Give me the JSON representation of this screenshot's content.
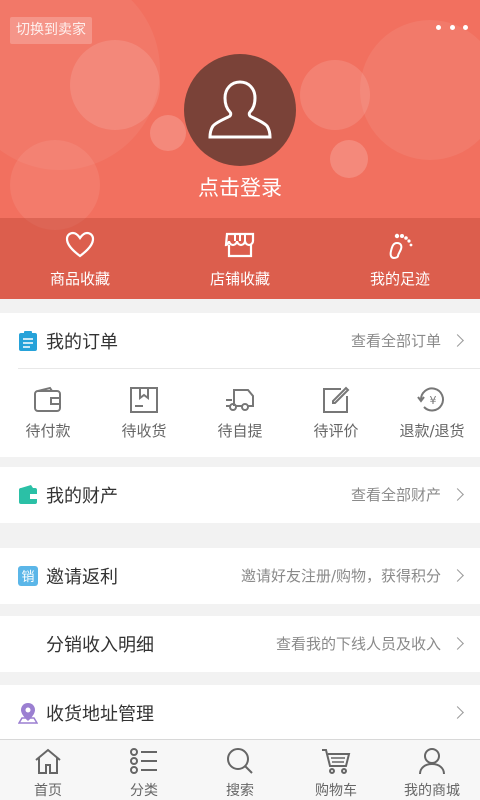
{
  "header": {
    "switch_label": "切换到卖家",
    "login_label": "点击登录",
    "favorites": [
      {
        "label": "商品收藏",
        "icon": "heart-icon"
      },
      {
        "label": "店铺收藏",
        "icon": "store-icon"
      },
      {
        "label": "我的足迹",
        "icon": "footprint-icon"
      }
    ]
  },
  "orders": {
    "title": "我的订单",
    "view_all": "查看全部订单",
    "statuses": [
      {
        "label": "待付款",
        "icon": "wallet-icon"
      },
      {
        "label": "待收货",
        "icon": "package-icon"
      },
      {
        "label": "待自提",
        "icon": "truck-icon"
      },
      {
        "label": "待评价",
        "icon": "edit-icon"
      },
      {
        "label": "退款/退货",
        "icon": "refund-icon"
      }
    ]
  },
  "assets": {
    "title": "我的财产",
    "view_all": "查看全部财产"
  },
  "invite": {
    "title": "邀请返利",
    "hint": "邀请好友注册/购物，获得积分",
    "badge": "销"
  },
  "distribution": {
    "title": "分销收入明细",
    "hint": "查看我的下线人员及收入"
  },
  "address": {
    "title": "收货地址管理"
  },
  "nav": {
    "items": [
      {
        "label": "首页",
        "icon": "home-icon"
      },
      {
        "label": "分类",
        "icon": "category-icon"
      },
      {
        "label": "搜索",
        "icon": "search-icon"
      },
      {
        "label": "购物车",
        "icon": "cart-icon"
      },
      {
        "label": "我的商城",
        "icon": "user-icon"
      }
    ]
  },
  "colors": {
    "brand": "#f2705f",
    "avatar_bg": "#7a4238",
    "order_icon": "#26a2d9",
    "asset_icon": "#2bc0a6",
    "invite_icon": "#5bb6e8",
    "address_icon": "#9b7fd1"
  }
}
